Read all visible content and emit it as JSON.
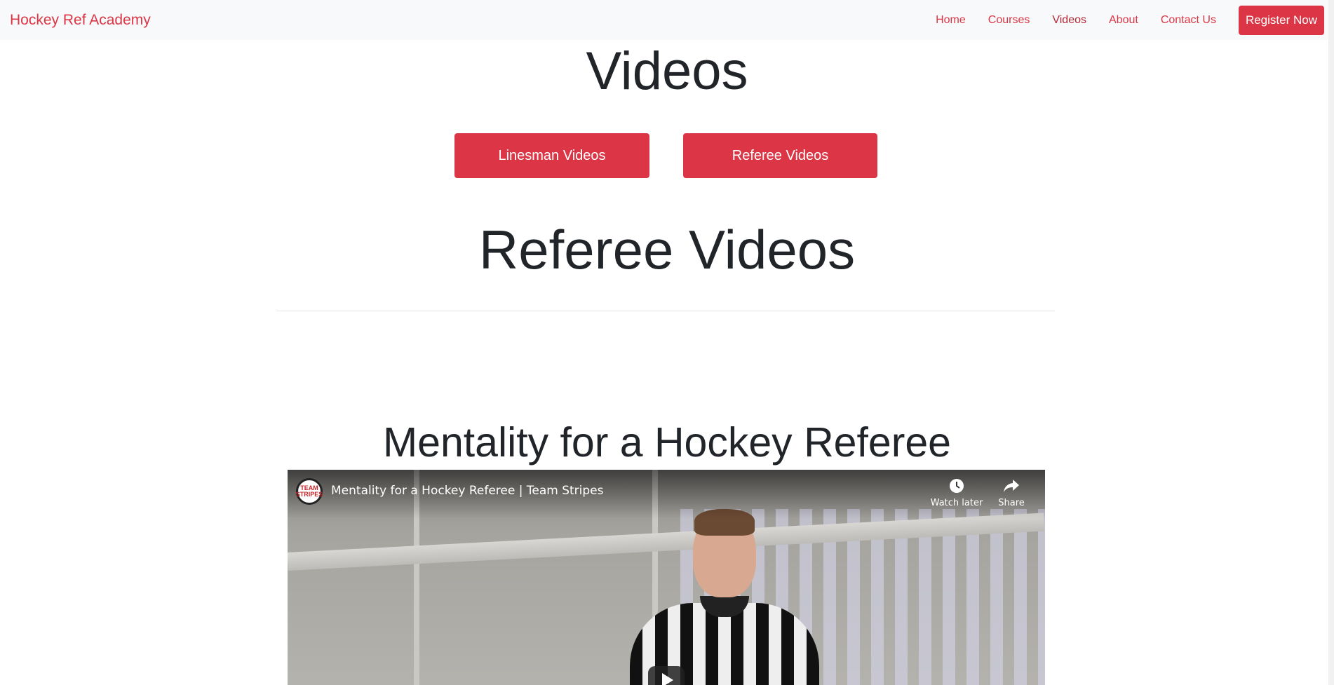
{
  "nav": {
    "brand": "Hockey Ref Academy",
    "links": [
      "Home",
      "Courses",
      "Videos",
      "About",
      "Contact Us"
    ],
    "register": "Register Now"
  },
  "page": {
    "title": "Videos",
    "filter_buttons": [
      "Linesman Videos",
      "Referee Videos"
    ],
    "section_title": "Referee Videos"
  },
  "video": {
    "heading": "Mentality for a Hockey Referee",
    "player_title": "Mentality for a Hockey Referee | Team Stripes",
    "channel_avatar_text": "TEAM STRIPES",
    "watch_later": "Watch later",
    "share": "Share",
    "watch_later_icon": "clock-icon",
    "share_icon": "share-arrow-icon"
  },
  "colors": {
    "accent": "#dc3545",
    "navbar_bg": "#f8f9fa"
  }
}
